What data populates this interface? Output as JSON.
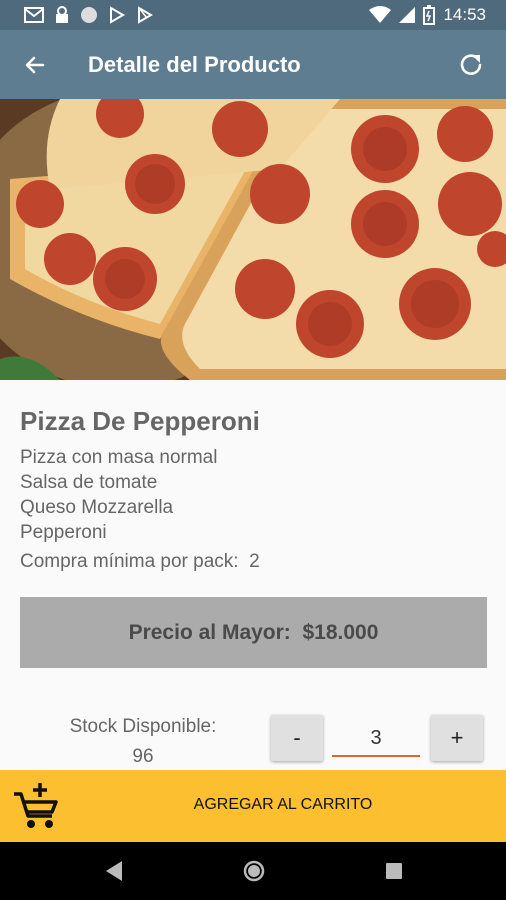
{
  "status_bar": {
    "time": "14:53",
    "icons": [
      "mail-icon",
      "lock-icon",
      "circle-icon",
      "download-icon",
      "play-store-icon",
      "wifi-icon",
      "signal-icon",
      "battery-icon"
    ]
  },
  "app_bar": {
    "title": "Detalle del Producto",
    "back_icon": "arrow-back-icon",
    "refresh_icon": "refresh-icon",
    "color": "#5e7d91"
  },
  "product": {
    "name": "Pizza De Pepperoni",
    "description_lines": [
      "Pizza con masa normal",
      "Salsa de tomate",
      "Queso Mozzarella",
      "Pepperoni"
    ],
    "min_purchase_label": "Compra mínima por pack:",
    "min_purchase_value": "2",
    "price_label": "Precio al Mayor:",
    "price_value": "$18.000"
  },
  "stock": {
    "label": "Stock Disponible:",
    "value": "96"
  },
  "quantity": {
    "minus_label": "-",
    "plus_label": "+",
    "value": "3"
  },
  "cart_button": {
    "label": "AGREGAR AL CARRITO",
    "icon": "add-shopping-cart-icon",
    "color": "#fbbf30"
  },
  "nav_bar": {
    "icons": [
      "nav-back-icon",
      "nav-home-icon",
      "nav-recent-icon"
    ]
  }
}
